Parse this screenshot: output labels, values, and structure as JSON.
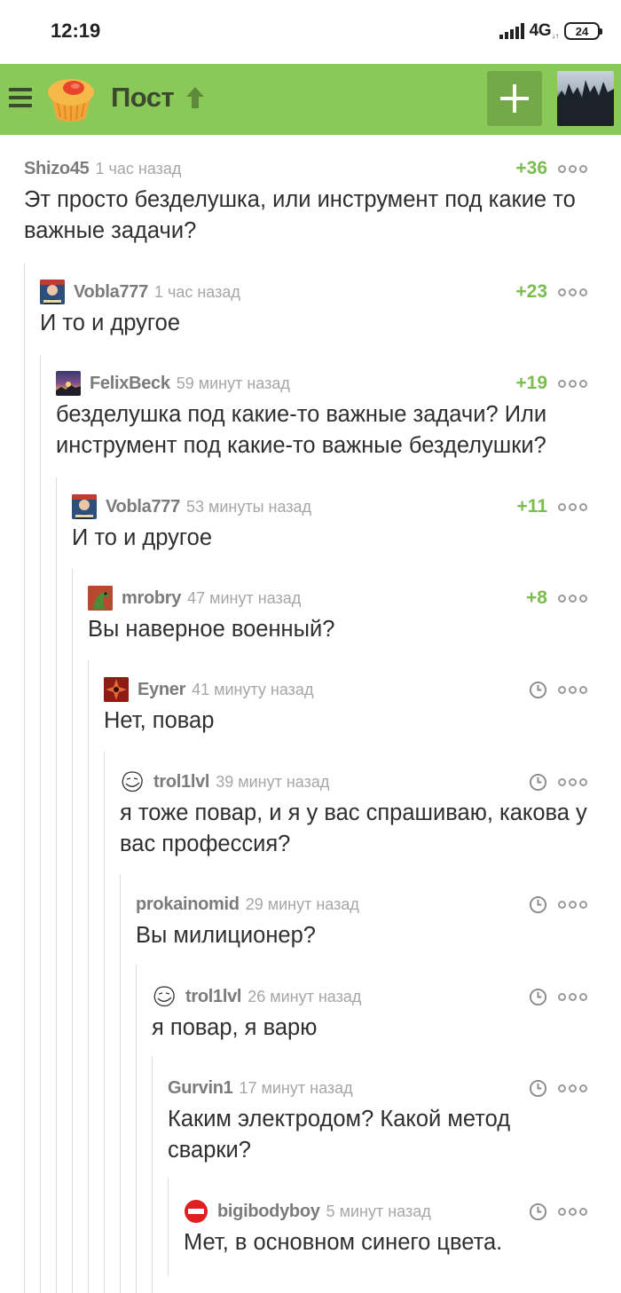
{
  "status_bar": {
    "time": "12:19",
    "network": "4G",
    "battery": "24"
  },
  "header": {
    "title": "Пост",
    "brand_color": "#8ac858"
  },
  "comments": [
    {
      "user": "Shizo45",
      "time": "1 час назад",
      "rating": "+36",
      "text": "Эт просто безделушка, или инструмент под какие то важные задачи?",
      "avatar": null
    },
    {
      "user": "Vobla777",
      "time": "1 час назад",
      "rating": "+23",
      "text": "И то и другое",
      "avatar": "portrait-avatar"
    },
    {
      "user": "FelixBeck",
      "time": "59 минут назад",
      "rating": "+19",
      "text": "безделушка под какие-то важные задачи? Или инструмент под какие-то важные безделушки?",
      "avatar": "sunset-avatar"
    },
    {
      "user": "Vobla777",
      "time": "53 минуты назад",
      "rating": "+11",
      "text": "И то и другое",
      "avatar": "portrait-avatar"
    },
    {
      "user": "mrobry",
      "time": "47 минут назад",
      "rating": "+8",
      "text": "Вы наверное военный?",
      "avatar": "dinosaur-avatar"
    },
    {
      "user": "Eyner",
      "time": "41 минуту назад",
      "rating": null,
      "text": "Нет, повар",
      "avatar": "emblem-avatar"
    },
    {
      "user": "trol1lvl",
      "time": "39 минут назад",
      "rating": null,
      "text": "я тоже повар, и я у вас спрашиваю, какова у вас профессия?",
      "avatar": "trollface-avatar"
    },
    {
      "user": "prokainomid",
      "time": "29 минут назад",
      "rating": null,
      "text": "Вы милиционер?",
      "avatar": null
    },
    {
      "user": "trol1lvl",
      "time": "26 минут назад",
      "rating": null,
      "text": "я повар, я варю",
      "avatar": "trollface-avatar"
    },
    {
      "user": "Gurvin1",
      "time": "17 минут назад",
      "rating": null,
      "text": "Каким электродом? Какой метод сварки?",
      "avatar": null
    },
    {
      "user": "bigibodyboy",
      "time": "5 минут назад",
      "rating": null,
      "text": "Мет, в основном синего цвета.",
      "avatar": "no-entry-avatar"
    }
  ],
  "colors": {
    "rating_positive": "#7bbd4e",
    "username": "#7b7b7b",
    "timestamp": "#a6a6a6",
    "thread_line": "#dcdcdc"
  }
}
